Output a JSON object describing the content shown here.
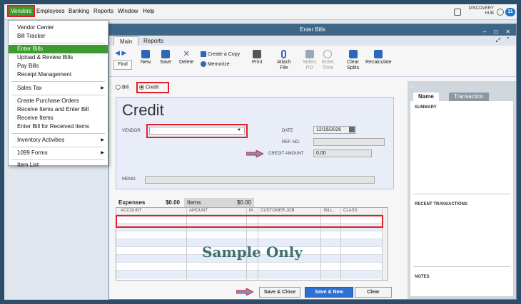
{
  "menubar": {
    "items": [
      "Vendors",
      "Employees",
      "Banking",
      "Reports",
      "Window",
      "Help"
    ],
    "discovery_line1": "DISCOVERY",
    "discovery_line2": "HUB",
    "badge": "11"
  },
  "vendors_menu": {
    "items": [
      {
        "label": "Vendor Center"
      },
      {
        "label": "Bill Tracker"
      },
      {
        "label": "Enter Bills"
      },
      {
        "label": "Upload & Review Bills"
      },
      {
        "label": "Pay Bills"
      },
      {
        "label": "Receipt Management"
      },
      {
        "label": "Sales Tax"
      },
      {
        "label": "Create Purchase Orders"
      },
      {
        "label": "Receive Items and Enter Bill"
      },
      {
        "label": "Receive Items"
      },
      {
        "label": "Enter Bill for Received Items"
      },
      {
        "label": "Inventory Activities"
      },
      {
        "label": "1099 Forms"
      },
      {
        "label": "Item List"
      }
    ]
  },
  "window": {
    "title": "Enter Bills",
    "tabs": [
      "Main",
      "Reports"
    ],
    "toolbar": {
      "find": "Find",
      "new": "New",
      "save": "Save",
      "delete": "Delete",
      "create_copy": "Create a Copy",
      "memorize": "Memorize",
      "print": "Print",
      "attach_line1": "Attach",
      "attach_line2": "File",
      "select_po_line1": "Select",
      "select_po_line2": "PO",
      "enter_time_line1": "Enter",
      "enter_time_line2": "Time",
      "clear_splits_line1": "Clear",
      "clear_splits_line2": "Splits",
      "recalculate": "Recalculate"
    },
    "bill_label": "Bill",
    "credit_label": "Credit",
    "form": {
      "heading": "Credit",
      "vendor_label": "VENDOR",
      "date_label": "DATE",
      "date_value": "12/15/2026",
      "ref_label": "REF. NO.",
      "credit_amount_label": "CREDIT AMOUNT",
      "credit_amount_value": "0.00",
      "memo_label": "MEMO"
    },
    "expenses_tab": {
      "label": "Expenses",
      "amount": "$0.00"
    },
    "items_tab": {
      "label": "Items",
      "amount": "$0.00"
    },
    "grid_headers": [
      "ACCOUNT",
      "AMOUNT",
      "M..",
      "CUSTOMER:JOB",
      "BILL..",
      "CLASS"
    ],
    "watermark": "Sample Only",
    "buttons": {
      "save_close": "Save & Close",
      "save_new": "Save & New",
      "clear": "Clear"
    }
  },
  "side_panel": {
    "tab_name": "Name",
    "tab_transaction": "Transaction",
    "summary": "SUMMARY",
    "recent_transactions": "RECENT TRANSACTIONS",
    "notes": "NOTES"
  }
}
